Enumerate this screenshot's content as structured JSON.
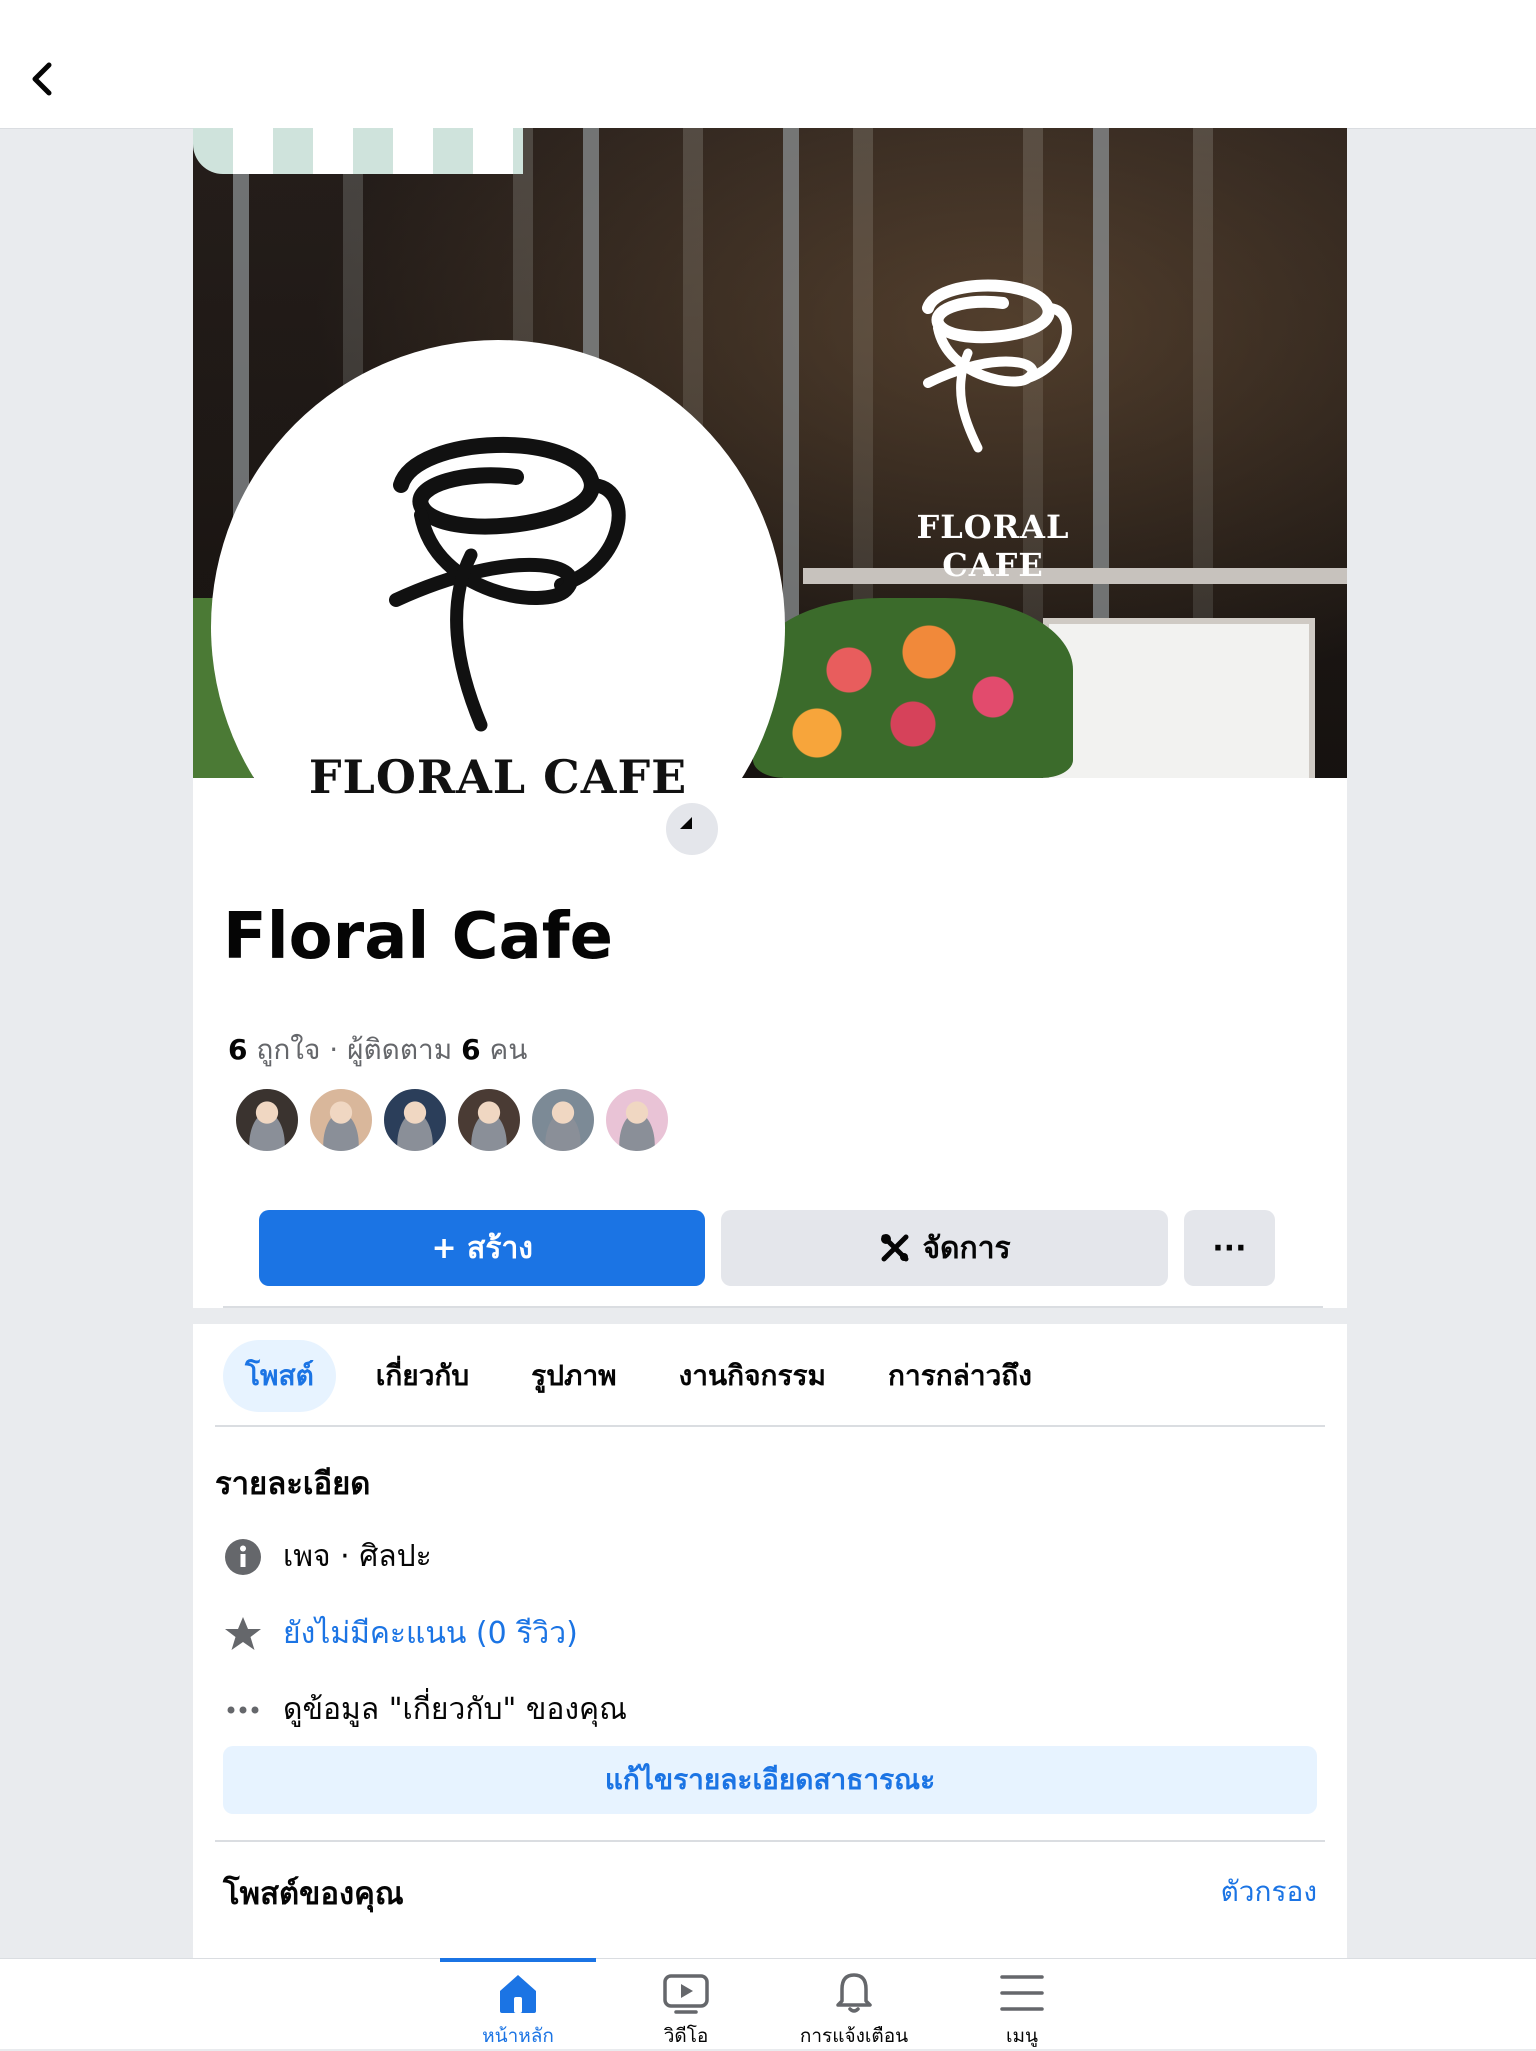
{
  "topbar": {
    "back_icon": "chevron-left-icon"
  },
  "cover": {
    "logo_text": "FLORAL CAFE"
  },
  "profile": {
    "avatar_text": "FLORAL CAFE",
    "name": "Floral Cafe",
    "likes_count": "6",
    "likes_label": "ถูกใจ",
    "followers_label": "ผู้ติดตาม",
    "followers_count": "6",
    "followers_unit": "คน",
    "friend_avatar_colors": [
      "#3a332f",
      "#d9b79b",
      "#2b3e5a",
      "#4a3b34",
      "#7c8a96",
      "#e9c3d6"
    ]
  },
  "actions": {
    "create_label": "+ สร้าง",
    "manage_label": "จัดการ",
    "more_label": "···"
  },
  "tabs": [
    {
      "label": "โพสต์",
      "active": true
    },
    {
      "label": "เกี่ยวกับ"
    },
    {
      "label": "รูปภาพ"
    },
    {
      "label": "งานกิจกรรม"
    },
    {
      "label": "การกล่าวถึง"
    }
  ],
  "details": {
    "title": "รายละเอียด",
    "category": "เพจ · ศิลปะ",
    "rating": "ยังไม่มีคะแนน (0 รีวิว)",
    "about": "ดูข้อมูล \"เกี่ยวกับ\" ของคุณ",
    "edit_button": "แก้ไขรายละเอียดสาธารณะ"
  },
  "posts": {
    "title": "โพสต์ของคุณ",
    "filter_label": "ตัวกรอง"
  },
  "bottom_nav": [
    {
      "label": "หน้าหลัก",
      "icon": "home-icon",
      "active": true
    },
    {
      "label": "วิดีโอ",
      "icon": "video-icon"
    },
    {
      "label": "การแจ้งเตือน",
      "icon": "bell-icon"
    },
    {
      "label": "เมนู",
      "icon": "menu-icon"
    }
  ],
  "colors": {
    "accent": "#1b74e4",
    "accent_light": "#e7f3ff",
    "background": "#e9ebee"
  }
}
